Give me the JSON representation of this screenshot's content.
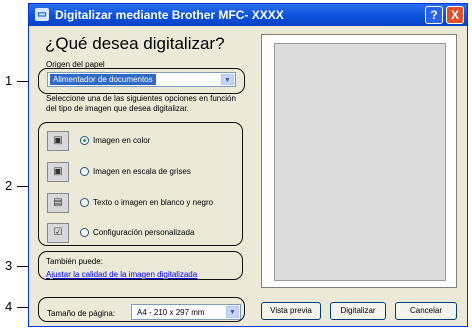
{
  "callouts": [
    "1",
    "2",
    "3",
    "4"
  ],
  "window": {
    "title": "Digitalizar mediante Brother MFC- XXXX",
    "help_btn": "?",
    "close_btn": "X"
  },
  "heading": "¿Qué desea digitalizar?",
  "origin": {
    "label": "Origen del papel",
    "value": "Alimentador de documentos"
  },
  "instructions": "Seleccione una de las siguientes opciones en función del tipo de imagen que desea digitalizar.",
  "options": [
    {
      "label": "Imagen en color",
      "icon": "color-image-icon",
      "selected": true
    },
    {
      "label": "Imagen en escala de grises",
      "icon": "grayscale-image-icon",
      "selected": false
    },
    {
      "label": "Texto o imagen en blanco y negro",
      "icon": "bw-text-icon",
      "selected": false
    },
    {
      "label": "Configuración personalizada",
      "icon": "custom-settings-icon",
      "selected": false
    }
  ],
  "also": {
    "label": "También puede:",
    "link": "Ajustar la calidad de la imagen digitalizada"
  },
  "page_size": {
    "label": "Tamaño de página:",
    "value": "A4 - 210 x 297 mm"
  },
  "buttons": {
    "preview": "Vista previa",
    "scan": "Digitalizar",
    "cancel": "Cancelar"
  }
}
